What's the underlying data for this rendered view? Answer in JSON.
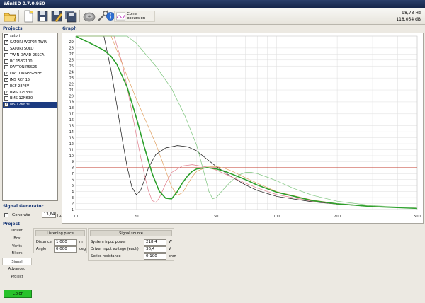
{
  "window": {
    "title": "WinISD 0.7.0.950"
  },
  "toolbar": {
    "buttons": [
      {
        "icon": "open-folder-icon"
      },
      {
        "icon": "new-file-icon"
      },
      {
        "icon": "save-icon"
      },
      {
        "icon": "save-as-icon"
      },
      {
        "icon": "save-all-icon"
      },
      {
        "icon": "driver-db-icon"
      },
      {
        "icon": "tools-icon"
      },
      {
        "icon": "info-icon"
      }
    ],
    "cone_excursion_label": "Cone excursion",
    "readout_frequency": "98,73 Hz",
    "readout_value": "118,054 dB"
  },
  "projects": {
    "title": "Projects",
    "items": [
      {
        "label": "satori",
        "checked": false,
        "selected": false
      },
      {
        "label": "SATORI WOP24 TWIN",
        "checked": true,
        "selected": false
      },
      {
        "label": "SATORI SOLO",
        "checked": false,
        "selected": false
      },
      {
        "label": "TWIN DAVID 25SCA",
        "checked": false,
        "selected": false
      },
      {
        "label": "BC 15BG100",
        "checked": false,
        "selected": false
      },
      {
        "label": "DAYTON RSS26",
        "checked": false,
        "selected": false
      },
      {
        "label": "DAYTON RSS28HF",
        "checked": true,
        "selected": false
      },
      {
        "label": "JMS RCF 15",
        "checked": true,
        "selected": false
      },
      {
        "label": "RCF 28P8V",
        "checked": false,
        "selected": false
      },
      {
        "label": "BMS 12S330",
        "checked": true,
        "selected": false
      },
      {
        "label": "BMS 12N630",
        "checked": false,
        "selected": false
      },
      {
        "label": "MS 12N630",
        "checked": true,
        "selected": true
      }
    ]
  },
  "graph": {
    "title": "Graph",
    "colors": {
      "grid": "#dedede",
      "reference_line": "#c0392b"
    },
    "chart_data": {
      "type": "line",
      "xscale": "log",
      "xlim": [
        10,
        500
      ],
      "ylim": [
        1,
        30
      ],
      "x_ticks": [
        "10",
        "20",
        "50",
        "100",
        "200",
        "500"
      ],
      "y_ticks": [
        "1",
        "2",
        "3",
        "4",
        "5",
        "6",
        "7",
        "8",
        "9",
        "10",
        "11",
        "12",
        "13",
        "14",
        "15",
        "16",
        "17",
        "18",
        "19",
        "20",
        "21",
        "22",
        "23",
        "24",
        "25",
        "26",
        "27",
        "28",
        "29"
      ],
      "grid": true,
      "reference_line": {
        "y": 8,
        "color": "#c0392b"
      },
      "series": [
        {
          "color": "#111111",
          "width": 0.7,
          "x": [
            10,
            13.8,
            15,
            16,
            17,
            18,
            19,
            20,
            21,
            22,
            23,
            25,
            28,
            32,
            36,
            40,
            45,
            50,
            60,
            70,
            80,
            100,
            150,
            200,
            300,
            500
          ],
          "y": [
            30,
            30,
            24.2,
            18.5,
            12.9,
            8.2,
            4.8,
            3.5,
            4.2,
            6.0,
            8.0,
            10.2,
            11.3,
            11.7,
            11.5,
            10.8,
            9.4,
            8.2,
            6.4,
            5.1,
            4.2,
            3.2,
            2.3,
            1.9,
            1.5,
            1.25
          ]
        },
        {
          "color": "#e07b8a",
          "width": 0.7,
          "x": [
            10,
            15.5,
            17,
            18,
            19,
            20,
            21,
            22,
            23,
            24,
            25,
            26,
            28,
            30,
            34,
            38,
            45,
            50,
            60,
            70,
            80,
            100,
            150,
            200,
            300,
            500
          ],
          "y": [
            30,
            30,
            25.5,
            21.5,
            17.4,
            13.5,
            9.9,
            6.7,
            4.1,
            2.5,
            2.2,
            2.9,
            5.3,
            7.2,
            8.3,
            8.5,
            8.1,
            7.6,
            6.4,
            5.4,
            4.6,
            3.5,
            2.4,
            1.9,
            1.5,
            1.25
          ]
        },
        {
          "color": "#e0a060",
          "width": 0.7,
          "x": [
            10,
            15,
            20,
            25,
            30,
            32,
            34,
            36,
            38,
            40,
            45,
            50,
            55,
            60,
            70,
            80,
            100,
            150,
            200,
            300,
            500
          ],
          "y": [
            30,
            30,
            19.5,
            12.0,
            4.8,
            3.4,
            3.8,
            5.2,
            6.5,
            7.4,
            8.1,
            8.2,
            7.9,
            7.4,
            6.3,
            5.4,
            4.0,
            2.6,
            2.0,
            1.55,
            1.25
          ]
        },
        {
          "color": "#2ca02c",
          "width": 1.6,
          "x": [
            10,
            11,
            12,
            13,
            14,
            15,
            16,
            18,
            20,
            22,
            24,
            26,
            28,
            30,
            32,
            34,
            36,
            38,
            40,
            45,
            50,
            55,
            60,
            70,
            80,
            100,
            150,
            200,
            300,
            500
          ],
          "y": [
            30,
            29.3,
            28.7,
            28.1,
            27.5,
            26.6,
            25.3,
            21.5,
            16.4,
            11.3,
            7.0,
            4.1,
            2.9,
            2.8,
            4.0,
            5.5,
            6.6,
            7.4,
            7.8,
            8.0,
            7.8,
            7.4,
            6.9,
            6.0,
            5.1,
            3.9,
            2.5,
            1.95,
            1.5,
            1.2
          ]
        },
        {
          "color": "#7bc47b",
          "width": 0.7,
          "x": [
            10,
            15,
            18,
            20,
            25,
            30,
            35,
            40,
            44,
            46,
            48,
            50,
            55,
            60,
            65,
            70,
            75,
            80,
            90,
            100,
            120,
            150,
            200,
            300,
            500
          ],
          "y": [
            30,
            30,
            30,
            28.8,
            25.0,
            21.2,
            16.6,
            11.7,
            6.5,
            4.0,
            2.8,
            3.0,
            4.6,
            5.9,
            6.8,
            7.2,
            7.2,
            7.0,
            6.4,
            5.8,
            4.6,
            3.4,
            2.4,
            1.65,
            1.25
          ]
        }
      ]
    }
  },
  "signal_generator": {
    "title": "Signal Generator",
    "generate_label": "Generate",
    "frequency_value": "13,64",
    "frequency_unit": "Hz"
  },
  "project": {
    "title": "Project",
    "nav": [
      {
        "label": "Driver",
        "active": false
      },
      {
        "label": "Box",
        "active": false
      },
      {
        "label": "Vents",
        "active": false
      },
      {
        "label": "Filters",
        "active": false
      },
      {
        "label": "Signal",
        "active": true
      },
      {
        "label": "Advanced",
        "active": false
      },
      {
        "label": "Project",
        "active": false
      }
    ],
    "color_button": "Color",
    "color_swatch": "#27c22a"
  },
  "listening_place": {
    "header": "Listening place",
    "distance_label": "Distance",
    "distance_value": "1,000",
    "distance_unit": "m",
    "angle_label": "Angle",
    "angle_value": "0,000",
    "angle_unit": "deg"
  },
  "signal_source": {
    "header": "Signal source",
    "power_label": "System input power",
    "power_value": "218,4",
    "power_unit": "W",
    "voltage_label": "Driver input voltage (each)",
    "voltage_value": "36,4",
    "voltage_unit": "V",
    "resistance_label": "Series resistance",
    "resistance_value": "0,100",
    "resistance_unit": "ohm"
  }
}
